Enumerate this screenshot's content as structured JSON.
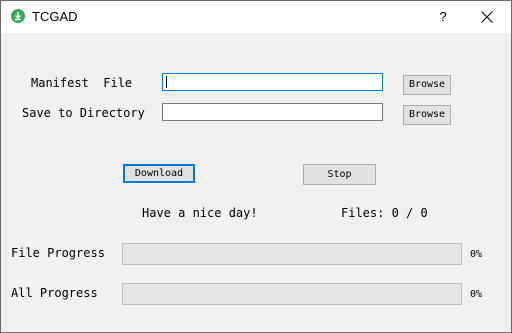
{
  "window": {
    "title": "TCGAD",
    "help_label": "?"
  },
  "form": {
    "manifest_label": "Manifest  File",
    "manifest_value": "",
    "browse_manifest_label": "Browse",
    "save_dir_label": "Save to Directory",
    "save_dir_value": "",
    "browse_dir_label": "Browse"
  },
  "actions": {
    "download_label": "Download",
    "stop_label": "Stop"
  },
  "status": {
    "message": "Have a nice day!",
    "files_text": "Files: 0 / 0"
  },
  "progress": {
    "file_label": "File Progress",
    "file_value": 0,
    "file_pct_text": "0%",
    "all_label": "All Progress",
    "all_value": 0,
    "all_pct_text": "0%"
  },
  "colors": {
    "app_icon": "#3aa655",
    "focus_border": "#0078d7",
    "progress_fill": "#06b025"
  },
  "icons": {
    "app": "download-icon",
    "close": "close-icon"
  }
}
